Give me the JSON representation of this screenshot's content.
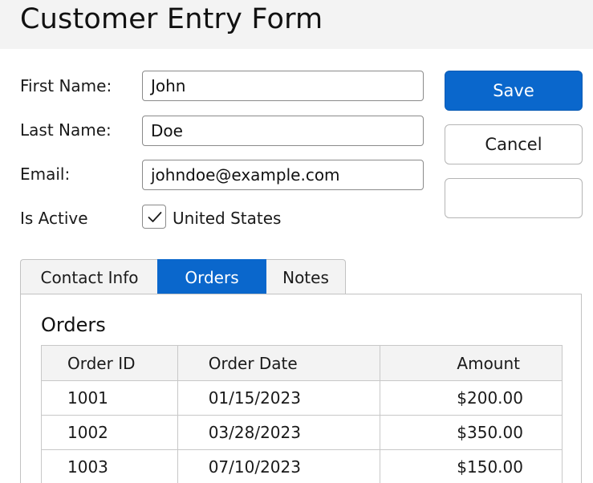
{
  "header": {
    "title": "Customer Entry Form"
  },
  "form": {
    "first_name": {
      "label": "First Name:",
      "value": "John"
    },
    "last_name": {
      "label": "Last Name:",
      "value": "Doe"
    },
    "email": {
      "label": "Email:",
      "value": "johndoe@example.com"
    },
    "is_active": {
      "label": "Is Active",
      "checked": true,
      "checkbox_label": "United States"
    }
  },
  "buttons": {
    "save_label": "Save",
    "cancel_label": "Cancel",
    "third_label": ""
  },
  "tabs": [
    {
      "label": "Contact Info",
      "selected": false
    },
    {
      "label": "Orders",
      "selected": true
    },
    {
      "label": "Notes",
      "selected": false
    }
  ],
  "orders": {
    "title": "Orders",
    "columns": [
      "Order ID",
      "Order Date",
      "Amount"
    ],
    "rows": [
      [
        "1001",
        "01/15/2023",
        "$200.00"
      ],
      [
        "1002",
        "03/28/2023",
        "$350.00"
      ],
      [
        "1003",
        "07/10/2023",
        "$150.00"
      ]
    ]
  },
  "colors": {
    "accent": "#0a67cc",
    "header_bg": "#f3f3f3",
    "border": "#8a8a8a"
  },
  "icons": {
    "checkmark": "checkmark-icon"
  }
}
